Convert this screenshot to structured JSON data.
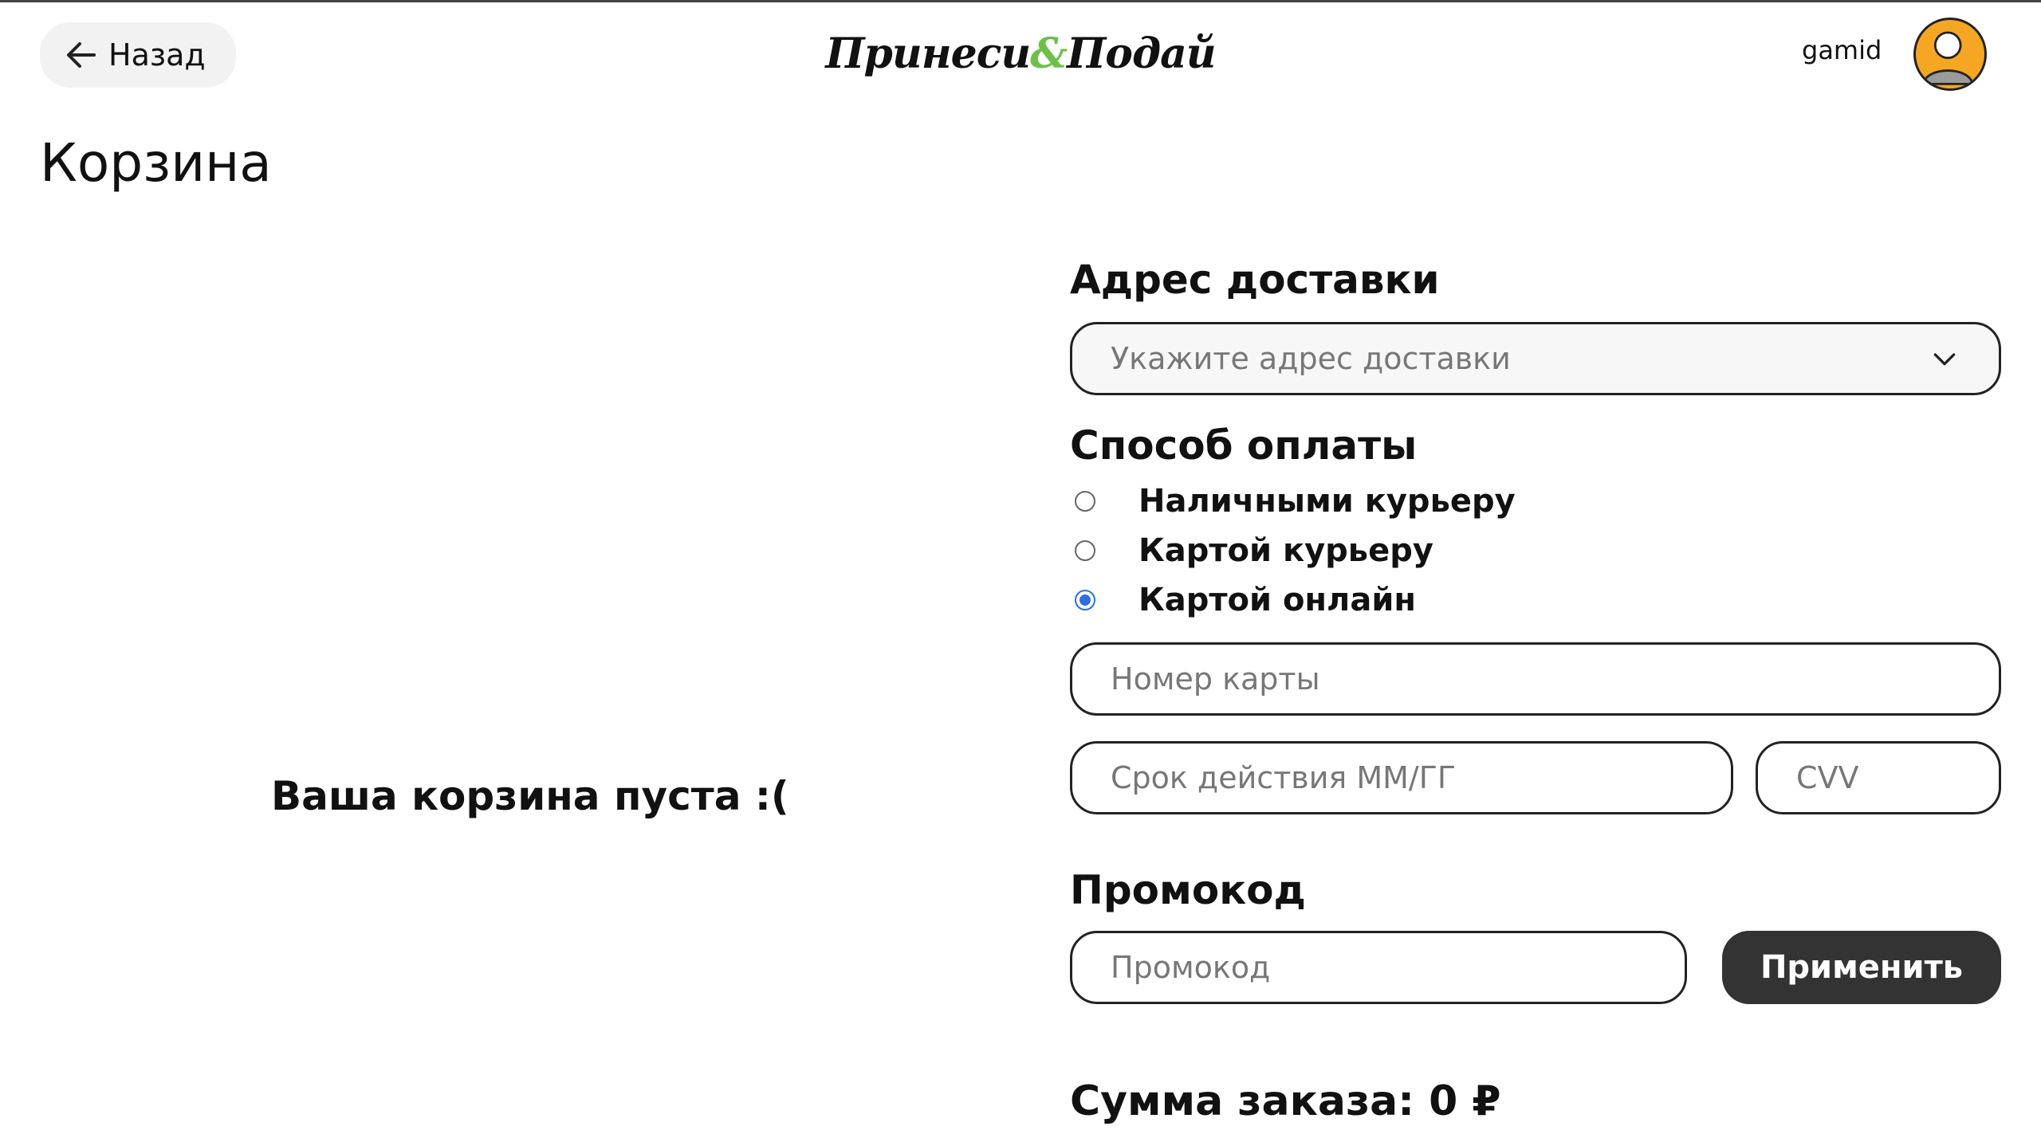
{
  "header": {
    "back_label": "Назад",
    "logo_part1": "Принеси",
    "logo_amp": "&",
    "logo_part2": "Подай",
    "username": "gamid"
  },
  "page": {
    "title": "Корзина",
    "empty_message": "Ваша корзина пуста :("
  },
  "delivery": {
    "heading": "Адрес доставки",
    "placeholder": "Укажите адрес доставки"
  },
  "payment": {
    "heading": "Способ оплаты",
    "options": [
      {
        "label": "Наличными курьеру",
        "selected": false
      },
      {
        "label": "Картой курьеру",
        "selected": false
      },
      {
        "label": "Картой онлайн",
        "selected": true
      }
    ],
    "card_number_placeholder": "Номер карты",
    "expiry_placeholder": "Срок действия ММ/ГГ",
    "cvv_placeholder": "CVV"
  },
  "promo": {
    "heading": "Промокод",
    "placeholder": "Промокод",
    "apply_label": "Применить"
  },
  "summary": {
    "total_text": "Сумма заказа: 0 ₽"
  },
  "colors": {
    "accent_radio": "#2f6fe0",
    "logo_amp": "#6fbf4a",
    "avatar": "#f5a623",
    "apply_button": "#333333"
  }
}
